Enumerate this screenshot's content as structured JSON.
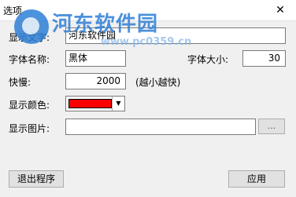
{
  "window": {
    "title": "选项",
    "close_glyph": "✕"
  },
  "watermark": {
    "name": "河东软件园",
    "url": "www.pc0359.cn"
  },
  "fields": {
    "display_text": {
      "label": "显示文字:",
      "value": "河东软件园"
    },
    "font_name": {
      "label": "字体名称:",
      "value": "黑体"
    },
    "font_size": {
      "label": "字体大小:",
      "value": "30"
    },
    "speed": {
      "label": "快慢:",
      "value": "2000",
      "hint": "(越小越快)"
    },
    "display_color": {
      "label": "显示颜色:",
      "value": "#ff0000",
      "arrow": "▼"
    },
    "display_image": {
      "label": "显示图片:",
      "value": "",
      "browse_label": "..."
    }
  },
  "buttons": {
    "exit": "退出程序",
    "apply": "应用"
  }
}
